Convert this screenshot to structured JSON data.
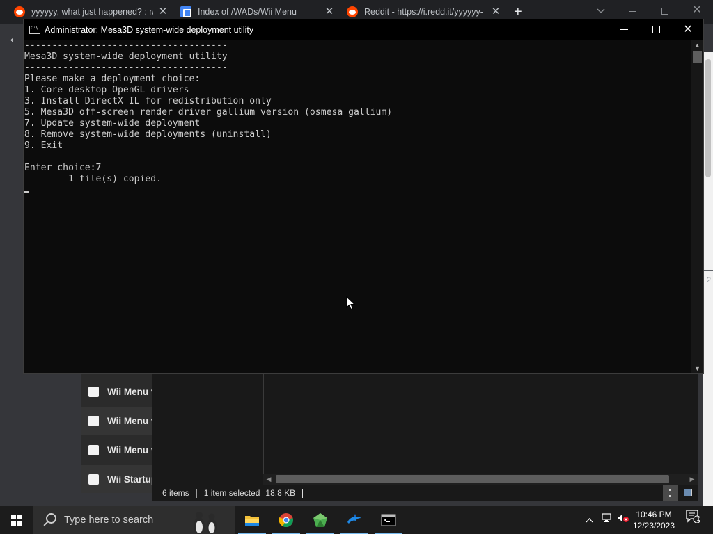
{
  "browser": {
    "tabs": [
      {
        "title": "yyyyyy, what just happened? : r/c",
        "icon": "reddit-icon",
        "close": "✕"
      },
      {
        "title": "Index of /WADs/Wii Menu",
        "icon": "document-icon",
        "close": "✕"
      },
      {
        "title": "Reddit - https://i.redd.it/yyyyyy-",
        "icon": "reddit-icon",
        "close": "✕"
      }
    ],
    "new_tab": "+",
    "back": "←",
    "side_number": "2"
  },
  "explorer": {
    "items": [
      {
        "name": "Wii Menu v"
      },
      {
        "name": "Wii Menu v"
      },
      {
        "name": "Wii Menu v"
      },
      {
        "name": "Wii Startup"
      }
    ],
    "status": {
      "count": "6 items",
      "selected": "1 item selected",
      "size": "18.8 KB"
    }
  },
  "cmd": {
    "title": "Administrator:  Mesa3D system-wide deployment utility",
    "lines": [
      "-------------------------------------",
      "Mesa3D system-wide deployment utility",
      "-------------------------------------",
      "Please make a deployment choice:",
      "1. Core desktop OpenGL drivers",
      "3. Install DirectX IL for redistribution only",
      "5. Mesa3D off-screen render driver gallium version (osmesa gallium)",
      "7. Update system-wide deployment",
      "8. Remove system-wide deployments (uninstall)",
      "9. Exit",
      "",
      "Enter choice:7",
      "        1 file(s) copied.",
      ""
    ],
    "controls": {
      "minimize": "",
      "maximize": "",
      "close": "✕"
    }
  },
  "taskbar": {
    "search_placeholder": "Type here to search",
    "apps": [
      {
        "name": "File Explorer",
        "icon": "folder-icon"
      },
      {
        "name": "Google Chrome",
        "icon": "chrome-icon"
      },
      {
        "name": "Green app",
        "icon": "gem-icon"
      },
      {
        "name": "Dolphin",
        "icon": "dolphin-icon"
      },
      {
        "name": "Command Prompt",
        "icon": "cmd-icon"
      }
    ],
    "clock": {
      "time": "10:46 PM",
      "date": "12/23/2023"
    },
    "notifications_count": "1"
  },
  "colors": {
    "cmd_bg": "#0c0c0c",
    "cmd_text": "#cccccc",
    "taskbar_bg": "#1c1c1c",
    "accent": "#76b9ed"
  }
}
